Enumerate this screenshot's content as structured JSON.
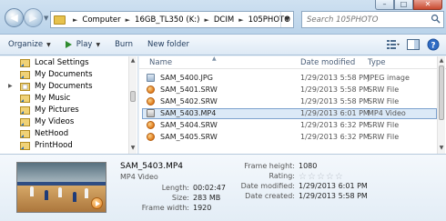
{
  "address": {
    "crumbs": [
      "Computer",
      "16GB_TL350 (K:)",
      "DCIM",
      "105PHOTO"
    ]
  },
  "search": {
    "placeholder": "Search 105PHOTO"
  },
  "toolbar": {
    "organize": "Organize",
    "play": "Play",
    "burn": "Burn",
    "new_folder": "New folder"
  },
  "nav": {
    "items": [
      "Local Settings",
      "My Documents",
      "My Documents",
      "My Music",
      "My Pictures",
      "My Videos",
      "NetHood",
      "PrintHood"
    ]
  },
  "columns": {
    "name": "Name",
    "date": "Date modified",
    "type": "Type"
  },
  "files": [
    {
      "name": "SAM_5400.JPG",
      "date": "1/29/2013 5:58 PM",
      "type": "JPEG image"
    },
    {
      "name": "SAM_5401.SRW",
      "date": "1/29/2013 5:58 PM",
      "type": "SRW File"
    },
    {
      "name": "SAM_5402.SRW",
      "date": "1/29/2013 5:58 PM",
      "type": "SRW File"
    },
    {
      "name": "SAM_5403.MP4",
      "date": "1/29/2013 6:01 PM",
      "type": "MP4 Video",
      "selected": true
    },
    {
      "name": "SAM_5404.SRW",
      "date": "1/29/2013 6:32 PM",
      "type": "SRW File"
    },
    {
      "name": "SAM_5405.SRW",
      "date": "1/29/2013 6:32 PM",
      "type": "SRW File"
    }
  ],
  "details": {
    "name": "SAM_5403.MP4",
    "type": "MP4 Video",
    "length_label": "Length:",
    "length": "00:02:47",
    "size_label": "Size:",
    "size": "283 MB",
    "frame_width_label": "Frame width:",
    "frame_width": "1920",
    "frame_height_label": "Frame height:",
    "frame_height": "1080",
    "rating_label": "Rating:",
    "rating": 0,
    "date_modified_label": "Date modified:",
    "date_modified": "1/29/2013 6:01 PM",
    "date_created_label": "Date created:",
    "date_created": "1/29/2013 5:58 PM"
  },
  "colors": {
    "selection": "#dbe9f7",
    "selection_border": "#7da2ce",
    "play_icon": "#2e8b2e",
    "header_text": "#4c607a"
  }
}
